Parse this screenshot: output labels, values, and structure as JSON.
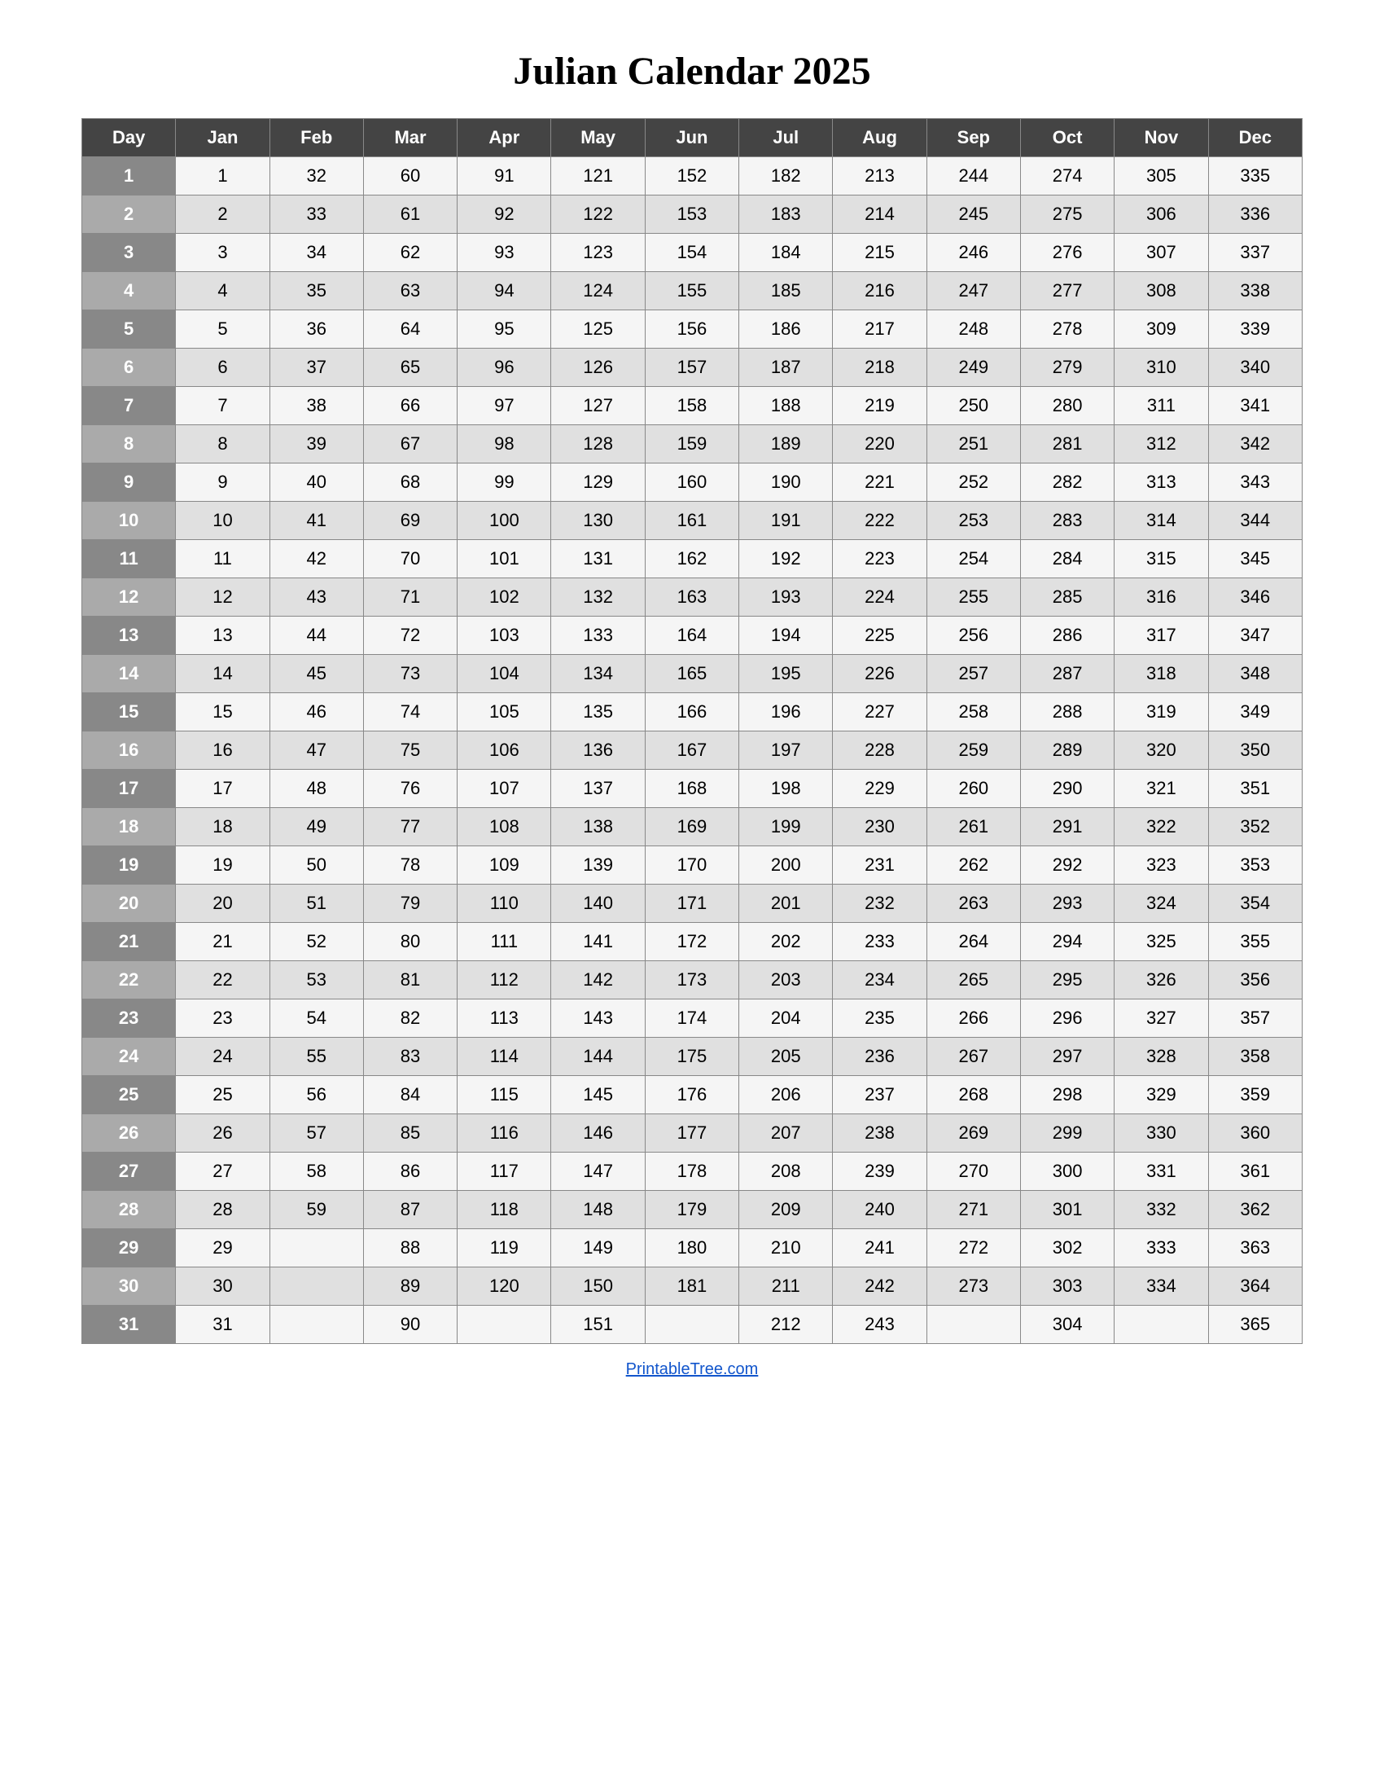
{
  "title": "Julian Calendar 2025",
  "footer": "PrintableTree.com",
  "columns": [
    "Day",
    "Jan",
    "Feb",
    "Mar",
    "Apr",
    "May",
    "Jun",
    "Jul",
    "Aug",
    "Sep",
    "Oct",
    "Nov",
    "Dec"
  ],
  "rows": [
    [
      1,
      1,
      32,
      60,
      91,
      121,
      152,
      182,
      213,
      244,
      274,
      305,
      335
    ],
    [
      2,
      2,
      33,
      61,
      92,
      122,
      153,
      183,
      214,
      245,
      275,
      306,
      336
    ],
    [
      3,
      3,
      34,
      62,
      93,
      123,
      154,
      184,
      215,
      246,
      276,
      307,
      337
    ],
    [
      4,
      4,
      35,
      63,
      94,
      124,
      155,
      185,
      216,
      247,
      277,
      308,
      338
    ],
    [
      5,
      5,
      36,
      64,
      95,
      125,
      156,
      186,
      217,
      248,
      278,
      309,
      339
    ],
    [
      6,
      6,
      37,
      65,
      96,
      126,
      157,
      187,
      218,
      249,
      279,
      310,
      340
    ],
    [
      7,
      7,
      38,
      66,
      97,
      127,
      158,
      188,
      219,
      250,
      280,
      311,
      341
    ],
    [
      8,
      8,
      39,
      67,
      98,
      128,
      159,
      189,
      220,
      251,
      281,
      312,
      342
    ],
    [
      9,
      9,
      40,
      68,
      99,
      129,
      160,
      190,
      221,
      252,
      282,
      313,
      343
    ],
    [
      10,
      10,
      41,
      69,
      100,
      130,
      161,
      191,
      222,
      253,
      283,
      314,
      344
    ],
    [
      11,
      11,
      42,
      70,
      101,
      131,
      162,
      192,
      223,
      254,
      284,
      315,
      345
    ],
    [
      12,
      12,
      43,
      71,
      102,
      132,
      163,
      193,
      224,
      255,
      285,
      316,
      346
    ],
    [
      13,
      13,
      44,
      72,
      103,
      133,
      164,
      194,
      225,
      256,
      286,
      317,
      347
    ],
    [
      14,
      14,
      45,
      73,
      104,
      134,
      165,
      195,
      226,
      257,
      287,
      318,
      348
    ],
    [
      15,
      15,
      46,
      74,
      105,
      135,
      166,
      196,
      227,
      258,
      288,
      319,
      349
    ],
    [
      16,
      16,
      47,
      75,
      106,
      136,
      167,
      197,
      228,
      259,
      289,
      320,
      350
    ],
    [
      17,
      17,
      48,
      76,
      107,
      137,
      168,
      198,
      229,
      260,
      290,
      321,
      351
    ],
    [
      18,
      18,
      49,
      77,
      108,
      138,
      169,
      199,
      230,
      261,
      291,
      322,
      352
    ],
    [
      19,
      19,
      50,
      78,
      109,
      139,
      170,
      200,
      231,
      262,
      292,
      323,
      353
    ],
    [
      20,
      20,
      51,
      79,
      110,
      140,
      171,
      201,
      232,
      263,
      293,
      324,
      354
    ],
    [
      21,
      21,
      52,
      80,
      111,
      141,
      172,
      202,
      233,
      264,
      294,
      325,
      355
    ],
    [
      22,
      22,
      53,
      81,
      112,
      142,
      173,
      203,
      234,
      265,
      295,
      326,
      356
    ],
    [
      23,
      23,
      54,
      82,
      113,
      143,
      174,
      204,
      235,
      266,
      296,
      327,
      357
    ],
    [
      24,
      24,
      55,
      83,
      114,
      144,
      175,
      205,
      236,
      267,
      297,
      328,
      358
    ],
    [
      25,
      25,
      56,
      84,
      115,
      145,
      176,
      206,
      237,
      268,
      298,
      329,
      359
    ],
    [
      26,
      26,
      57,
      85,
      116,
      146,
      177,
      207,
      238,
      269,
      299,
      330,
      360
    ],
    [
      27,
      27,
      58,
      86,
      117,
      147,
      178,
      208,
      239,
      270,
      300,
      331,
      361
    ],
    [
      28,
      28,
      59,
      87,
      118,
      148,
      179,
      209,
      240,
      271,
      301,
      332,
      362
    ],
    [
      29,
      29,
      "",
      88,
      119,
      149,
      180,
      210,
      241,
      272,
      302,
      333,
      363
    ],
    [
      30,
      30,
      "",
      89,
      120,
      150,
      181,
      211,
      242,
      273,
      303,
      334,
      364
    ],
    [
      31,
      31,
      "",
      90,
      "",
      151,
      "",
      212,
      243,
      "",
      304,
      "",
      365
    ]
  ]
}
